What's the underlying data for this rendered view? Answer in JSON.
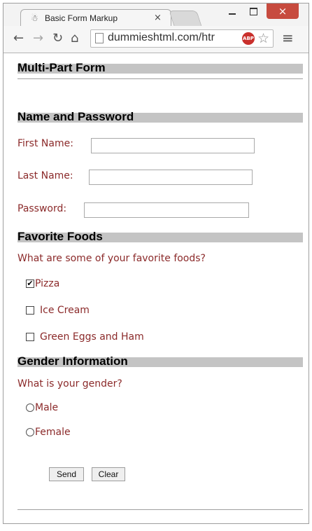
{
  "browser": {
    "tab_title": "Basic Form Markup",
    "tab_close": "×",
    "url": "dummieshtml.com/htr",
    "adblock_badge": "ABP",
    "close_glyph": "×",
    "icons": {
      "back": "arrow-left",
      "forward": "arrow-right",
      "reload": "refresh",
      "home": "home",
      "bookmark": "star",
      "menu": "hamburger"
    }
  },
  "page": {
    "form_title": "Multi-Part Form",
    "sections": {
      "name_password": {
        "heading": "Name and Password",
        "first_name_label": "First Name:",
        "last_name_label": "Last Name:",
        "password_label": "Password:"
      },
      "foods": {
        "heading": "Favorite Foods",
        "prompt": "What are some of your favorite foods?",
        "options": [
          {
            "label": "Pizza",
            "checked": true
          },
          {
            "label": "Ice Cream",
            "checked": false
          },
          {
            "label": "Green Eggs and Ham",
            "checked": false
          }
        ]
      },
      "gender": {
        "heading": "Gender Information",
        "prompt": "What is your gender?",
        "options": [
          {
            "label": "Male",
            "selected": false
          },
          {
            "label": "Female",
            "selected": false
          }
        ]
      }
    },
    "buttons": {
      "send": "Send",
      "clear": "Clear"
    },
    "colors": {
      "label_text": "#8b2a2a",
      "heading_bar": "#c4c4c4",
      "close_button": "#c74b3f"
    }
  }
}
